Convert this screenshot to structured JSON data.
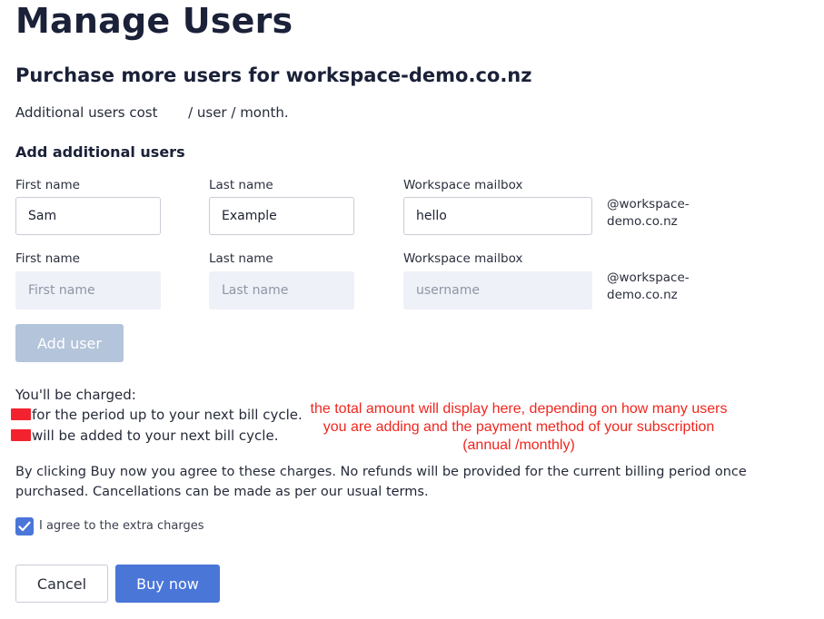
{
  "page": {
    "title": "Manage Users",
    "subtitle": "Purchase more users for workspace-demo.co.nz",
    "cost_prefix": "Additional users cost",
    "cost_suffix": "/ user / month.",
    "section_heading": "Add additional users"
  },
  "form": {
    "rows": [
      {
        "first_name_label": "First name",
        "first_name_value": "Sam",
        "first_name_placeholder": "First name",
        "last_name_label": "Last name",
        "last_name_value": "Example",
        "last_name_placeholder": "Last name",
        "mailbox_label": "Workspace mailbox",
        "mailbox_value": "hello",
        "mailbox_placeholder": "username",
        "domain_line1": "@workspace-",
        "domain_line2": "demo.co.nz"
      },
      {
        "first_name_label": "First name",
        "first_name_value": "",
        "first_name_placeholder": "First name",
        "last_name_label": "Last name",
        "last_name_value": "",
        "last_name_placeholder": "Last name",
        "mailbox_label": "Workspace mailbox",
        "mailbox_value": "",
        "mailbox_placeholder": "username",
        "domain_line1": "@workspace-",
        "domain_line2": "demo.co.nz"
      }
    ],
    "add_user_label": "Add user"
  },
  "charges": {
    "heading": "You'll be charged:",
    "line1": "for the period up to your next bill cycle.",
    "line2": "will be added to your next bill cycle.",
    "annotation": "the total amount will display here, depending on how many users you are adding and the payment method of your subscription (annual /monthly)"
  },
  "agreement": {
    "text": "By clicking Buy now you agree to these charges. No refunds will be provided for the current billing period once purchased. Cancellations can be made as per our usual",
    "terms_link": "terms",
    "terms_end": ".",
    "checkbox_label": "I agree to the extra charges",
    "checkbox_checked": true
  },
  "actions": {
    "cancel_label": "Cancel",
    "buy_label": "Buy now"
  },
  "colors": {
    "primary": "#4a76d8",
    "disabled_button": "#b4c4da",
    "redaction": "#f2232f",
    "annotation": "#f0261e"
  }
}
